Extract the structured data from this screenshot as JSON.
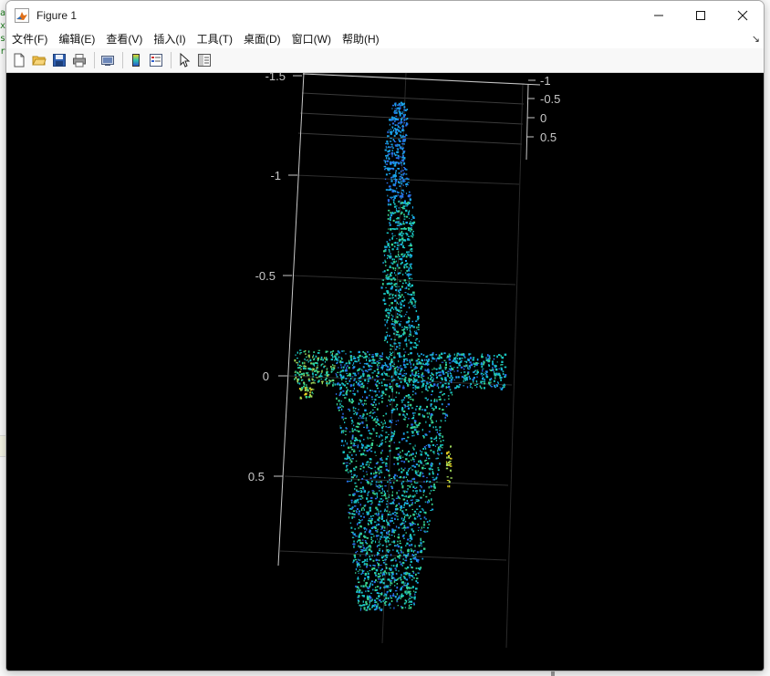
{
  "window": {
    "title": "Figure 1",
    "controls": [
      "minimize-icon",
      "maximize-icon",
      "close-icon"
    ]
  },
  "menu": [
    "文件(F)",
    "编辑(E)",
    "查看(V)",
    "插入(I)",
    "工具(T)",
    "桌面(D)",
    "窗口(W)",
    "帮助(H)"
  ],
  "toolbar": [
    "new-figure-icon",
    "open-file-icon",
    "save-icon",
    "print-icon",
    "link-plot-icon",
    "insert-colorbar-icon",
    "insert-legend-icon",
    "edit-plot-arrow-icon",
    "property-inspector-icon"
  ],
  "background_editor": {
    "gutter_chars": [
      "a",
      "x",
      "s",
      "r"
    ]
  },
  "axes": {
    "left_ticks": [
      "-1.5",
      "-1",
      "-0.5",
      "0",
      "0.5"
    ],
    "right_ticks": [
      "-1",
      "-0.5",
      "0",
      "0.5"
    ]
  },
  "colors": {
    "plot_bg": "#000000",
    "axis": "#c8c8c8",
    "grid": "#3a3a3a",
    "colormap": [
      "#2a6de8",
      "#1aa3e8",
      "#18c4c4",
      "#38d28e",
      "#9ed65a",
      "#e8d020"
    ]
  }
}
